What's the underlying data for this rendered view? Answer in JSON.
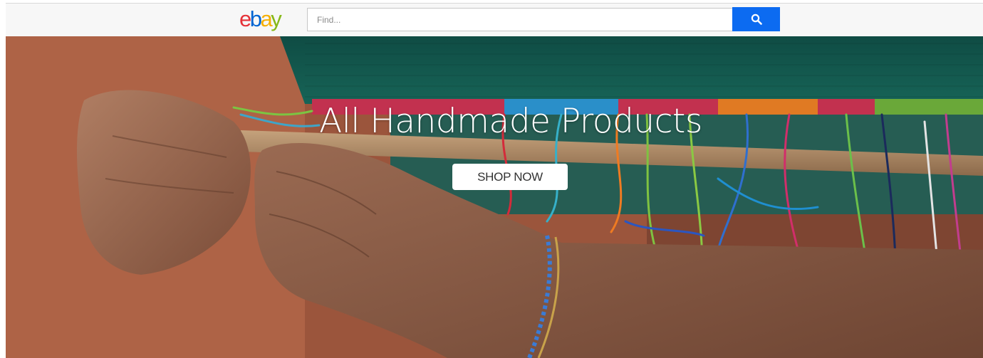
{
  "header": {
    "logo": {
      "e": "e",
      "b": "b",
      "a": "a",
      "y": "y"
    },
    "search": {
      "placeholder": "Find...",
      "value": "",
      "button_icon": "search-icon"
    }
  },
  "hero": {
    "title": "All Handmade Products",
    "cta_label": "SHOP NOW",
    "image": "handmade-weaving-hands-photo"
  },
  "colors": {
    "logo_e": "#e53238",
    "logo_b": "#0064d2",
    "logo_a": "#f5af02",
    "logo_y": "#86b817",
    "search_button": "#0c6bf1",
    "header_bg": "#f7f7f7"
  }
}
